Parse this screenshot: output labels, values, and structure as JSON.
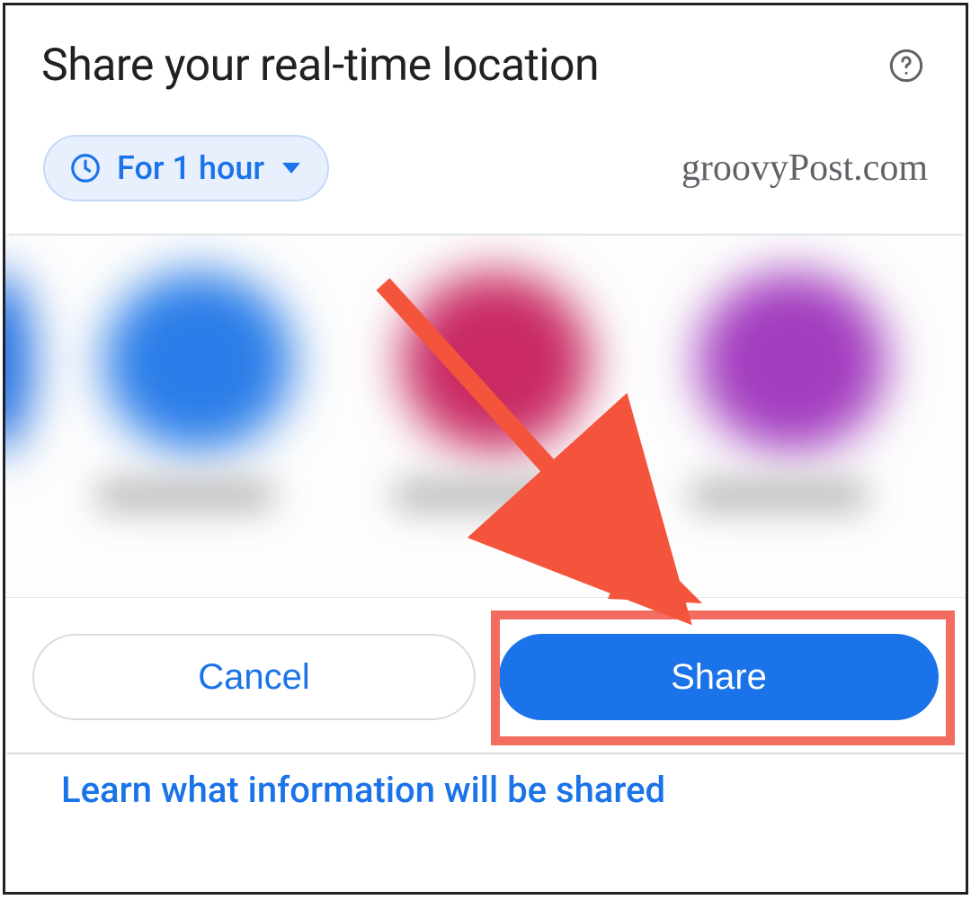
{
  "header": {
    "title": "Share your real-time location"
  },
  "duration": {
    "label": "For 1 hour"
  },
  "watermark": "groovyPost.com",
  "contacts": [
    {
      "color": "#1a6be0"
    },
    {
      "color": "#2a7de8"
    },
    {
      "color": "#c92a63"
    },
    {
      "color": "#a33dbf"
    }
  ],
  "buttons": {
    "cancel": "Cancel",
    "share": "Share"
  },
  "footer": {
    "link_label": "Learn what information will be shared"
  },
  "annotation": {
    "arrow_color": "#f4543b",
    "highlight_color": "#f26d5f"
  }
}
